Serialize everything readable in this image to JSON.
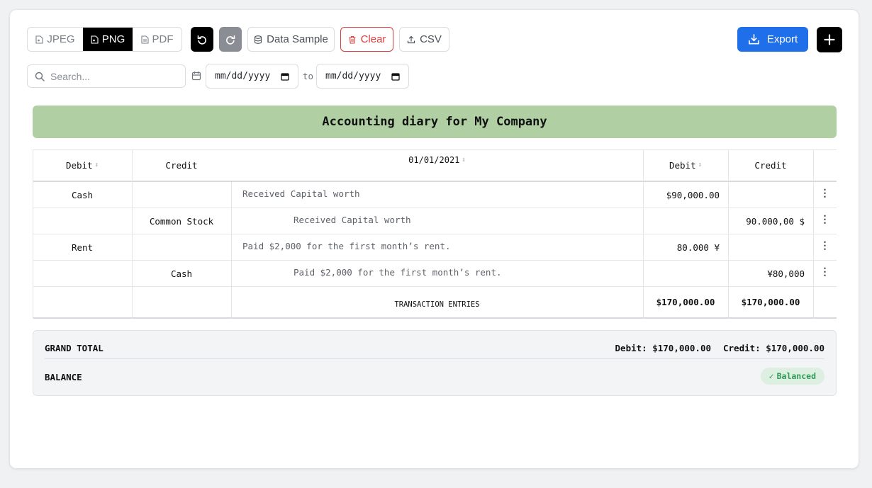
{
  "toolbar": {
    "formats": [
      {
        "label": "JPEG",
        "icon": "file-image-icon",
        "active": false
      },
      {
        "label": "PNG",
        "icon": "file-image-icon",
        "active": true
      },
      {
        "label": "PDF",
        "icon": "file-text-icon",
        "active": false
      }
    ],
    "undo_icon": "undo-icon",
    "redo_icon": "redo-icon",
    "data_sample_label": "Data Sample",
    "clear_label": "Clear",
    "csv_label": "CSV",
    "export_label": "Export",
    "add_icon": "plus-icon"
  },
  "filters": {
    "search_placeholder": "Search...",
    "date_from_placeholder": "mm/dd/yyyy",
    "date_to_placeholder": "mm/dd/yyyy",
    "to_label": "to"
  },
  "journal": {
    "title": "Accounting diary for My Company",
    "headers": {
      "debit_account": "Debit",
      "credit_account": "Credit",
      "date": "01/01/2021",
      "debit_amount": "Debit",
      "credit_amount": "Credit"
    },
    "rows": [
      {
        "debit_account": "Cash",
        "credit_account": "",
        "description": "Received Capital worth",
        "indented": false,
        "debit": "$90,000.00",
        "credit": ""
      },
      {
        "debit_account": "",
        "credit_account": "Common Stock",
        "description": "Received Capital worth",
        "indented": true,
        "debit": "",
        "credit": "90.000,00 $"
      },
      {
        "debit_account": "Rent",
        "credit_account": "",
        "description": "Paid $2,000 for the first month’s rent.",
        "indented": false,
        "debit": "80.000 ¥",
        "credit": ""
      },
      {
        "debit_account": "",
        "credit_account": "Cash",
        "description": "Paid $2,000 for the first month’s rent.",
        "indented": true,
        "debit": "",
        "credit": "¥80,000"
      }
    ],
    "footer": {
      "label": "TRANSACTION ENTRIES",
      "debit_total": "$170,000.00",
      "credit_total": "$170,000.00"
    }
  },
  "summary": {
    "grand_total_label": "GRAND TOTAL",
    "debit_text": "Debit: $170,000.00",
    "credit_text": "Credit: $170,000.00",
    "balance_label": "BALANCE",
    "balance_status": "Balanced",
    "status_color": "#2e9b57"
  },
  "colors": {
    "accent": "#1f6feb",
    "banner": "#b0d0a3",
    "danger": "#dc3b3b"
  }
}
